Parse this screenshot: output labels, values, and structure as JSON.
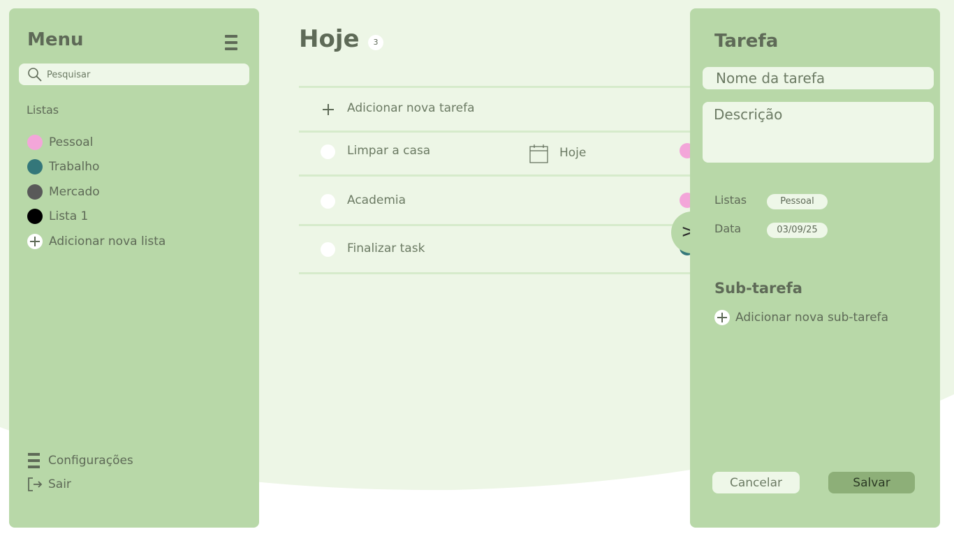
{
  "colors": {
    "panel_bg": "#b8d8a8",
    "page_bg": "#edf6e6",
    "input_bg": "#eef7e8",
    "text": "#5e6a57",
    "save_button": "#8daf78"
  },
  "sidebar": {
    "title": "Menu",
    "menu_icon": "hamburger-icon",
    "search": {
      "placeholder": "Pesquisar",
      "icon": "search-icon"
    },
    "lists_label": "Listas",
    "lists": [
      {
        "label": "Pessoal",
        "color": "#f3a6d9"
      },
      {
        "label": "Trabalho",
        "color": "#34777a"
      },
      {
        "label": "Mercado",
        "color": "#595959"
      },
      {
        "label": "Lista 1",
        "color": "#000000"
      }
    ],
    "add_list_label": "Adicionar nova lista",
    "settings_label": "Configurações",
    "logout_label": "Sair"
  },
  "main": {
    "title": "Hoje",
    "count": "3",
    "add_task_label": "Adicionar nova tarefa",
    "tasks": [
      {
        "label": "Limpar a casa",
        "date": "Hoje",
        "tag_color": "#f3a6d9"
      },
      {
        "label": "Academia",
        "date": "",
        "tag_color": "#f3a6d9"
      },
      {
        "label": "Finalizar task",
        "date": "",
        "tag_color": "#34777a"
      }
    ],
    "toggle_label": ">"
  },
  "panel": {
    "title": "Tarefa",
    "name_placeholder": "Nome da tarefa",
    "description_placeholder": "Descrição",
    "lists_label": "Listas",
    "list_value": "Pessoal",
    "date_label": "Data",
    "date_value": "03/09/25",
    "subtask_title": "Sub-tarefa",
    "add_subtask_label": "Adicionar nova sub-tarefa",
    "cancel_label": "Cancelar",
    "save_label": "Salvar"
  }
}
